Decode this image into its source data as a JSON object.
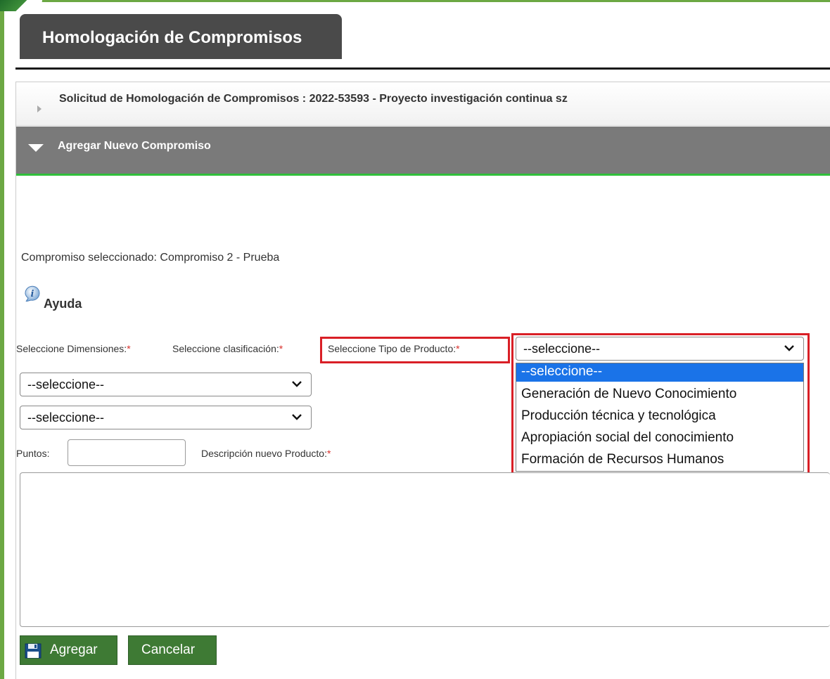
{
  "page": {
    "title": "Homologación de Compromisos"
  },
  "accordion": {
    "request_title": "Solicitud de Homologación de Compromisos : 2022-53593 - Proyecto investigación continua sz",
    "add_title": "Agregar Nuevo Compromiso"
  },
  "form": {
    "selected_commitment": "Compromiso seleccionado: Compromiso 2 - Prueba",
    "help_label": "Ayuda",
    "dimensions_label": "Seleccione Dimensiones:",
    "classification_label": "Seleccione clasificación:",
    "product_type_label": "Seleccione Tipo de Producto:",
    "required_mark": "*",
    "product_type_value": "--seleccione--",
    "dimensions_value": "--seleccione--",
    "classification_value": "--seleccione--",
    "points_label": "Puntos:",
    "description_label": "Descripción nuevo Producto:",
    "points_value": "",
    "description_value": ""
  },
  "dropdown": {
    "options": [
      "--seleccione--",
      "Generación de Nuevo Conocimiento",
      "Producción técnica y tecnológica",
      "Apropiación social del conocimiento",
      "Formación de Recursos Humanos"
    ],
    "highlighted_index": 0
  },
  "buttons": {
    "add_label": "Agregar",
    "cancel_label": "Cancelar"
  },
  "colors": {
    "frame_green": "#6ca843",
    "title_tab": "#4a4a4a",
    "accordion_open": "#7a7a7a",
    "accent_green_line": "#2fbf3a",
    "highlight_red": "#d91f26",
    "required_red": "#d9302b",
    "option_selected": "#1a73e8",
    "button_green": "#3e7a34"
  },
  "icons": {
    "collapsed_arrow": "triangle-right-icon",
    "open_arrow": "triangle-down-icon",
    "help": "info-icon",
    "select_chevron": "chevron-down-icon",
    "add_button": "floppy-disk-icon"
  }
}
